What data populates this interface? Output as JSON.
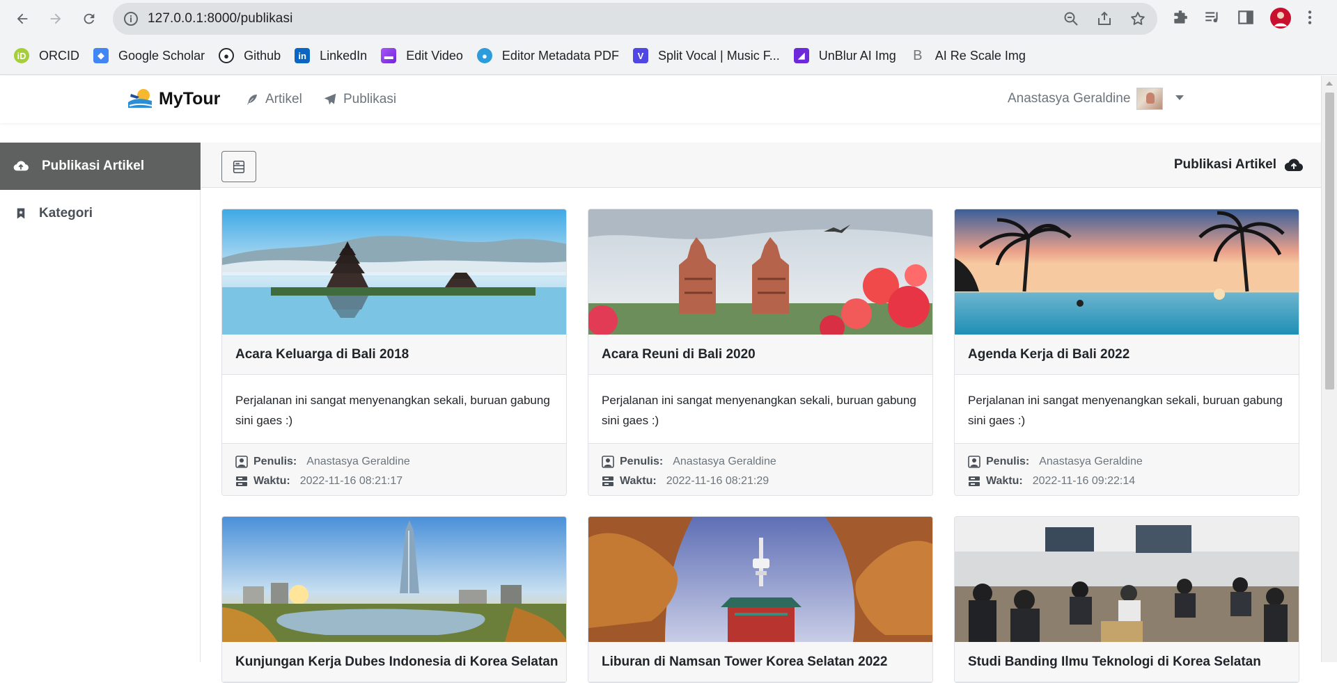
{
  "browser": {
    "url": "127.0.0.1:8000/publikasi",
    "bookmarks": [
      {
        "label": "ORCID",
        "icon": "orcid-icon",
        "color": "#a6ce39"
      },
      {
        "label": "Google Scholar",
        "icon": "scholar-icon",
        "color": "#4285f4"
      },
      {
        "label": "Github",
        "icon": "github-icon",
        "color": "#24292e"
      },
      {
        "label": "LinkedIn",
        "icon": "linkedin-icon",
        "color": "#0a66c2"
      },
      {
        "label": "Edit Video",
        "icon": "clapper-icon",
        "color": "#7b3fe4"
      },
      {
        "label": "Editor Metadata PDF",
        "icon": "people-icon",
        "color": "#2d9cdb"
      },
      {
        "label": "Split Vocal | Music F...",
        "icon": "v-icon",
        "color": "#4f46e5"
      },
      {
        "label": "UnBlur AI Img",
        "icon": "unblur-icon",
        "color": "#6d28d9"
      },
      {
        "label": "AI Re Scale Img",
        "icon": "b-icon",
        "color": "#888888"
      }
    ]
  },
  "nav": {
    "brand": "MyTour",
    "links": [
      "Artikel",
      "Publikasi"
    ],
    "user": "Anastasya Geraldine"
  },
  "sidebar": {
    "items": [
      {
        "label": "Publikasi Artikel",
        "active": true
      },
      {
        "label": "Kategori",
        "active": false
      }
    ]
  },
  "header": {
    "title": "Publikasi Artikel"
  },
  "labels": {
    "author": "Penulis:",
    "time": "Waktu:"
  },
  "cards": [
    {
      "title": "Acara Keluarga di Bali 2018",
      "body": "Perjalanan ini sangat menyenangkan sekali, buruan gabung sini gaes :)",
      "author": "Anastasya Geraldine",
      "time": "2022-11-16 08:21:17"
    },
    {
      "title": "Acara Reuni di Bali 2020",
      "body": "Perjalanan ini sangat menyenangkan sekali, buruan gabung sini gaes :)",
      "author": "Anastasya Geraldine",
      "time": "2022-11-16 08:21:29"
    },
    {
      "title": "Agenda Kerja di Bali 2022",
      "body": "Perjalanan ini sangat menyenangkan sekali, buruan gabung sini gaes :)",
      "author": "Anastasya Geraldine",
      "time": "2022-11-16 09:22:14"
    },
    {
      "title": "Kunjungan Kerja Dubes Indonesia di Korea Selatan"
    },
    {
      "title": "Liburan di Namsan Tower Korea Selatan 2022"
    },
    {
      "title": "Studi Banding Ilmu Teknologi di Korea Selatan"
    }
  ],
  "colors": {
    "sidebar_active": "#5f6160",
    "card_header": "#f7f7f7",
    "muted": "#6c757d"
  }
}
